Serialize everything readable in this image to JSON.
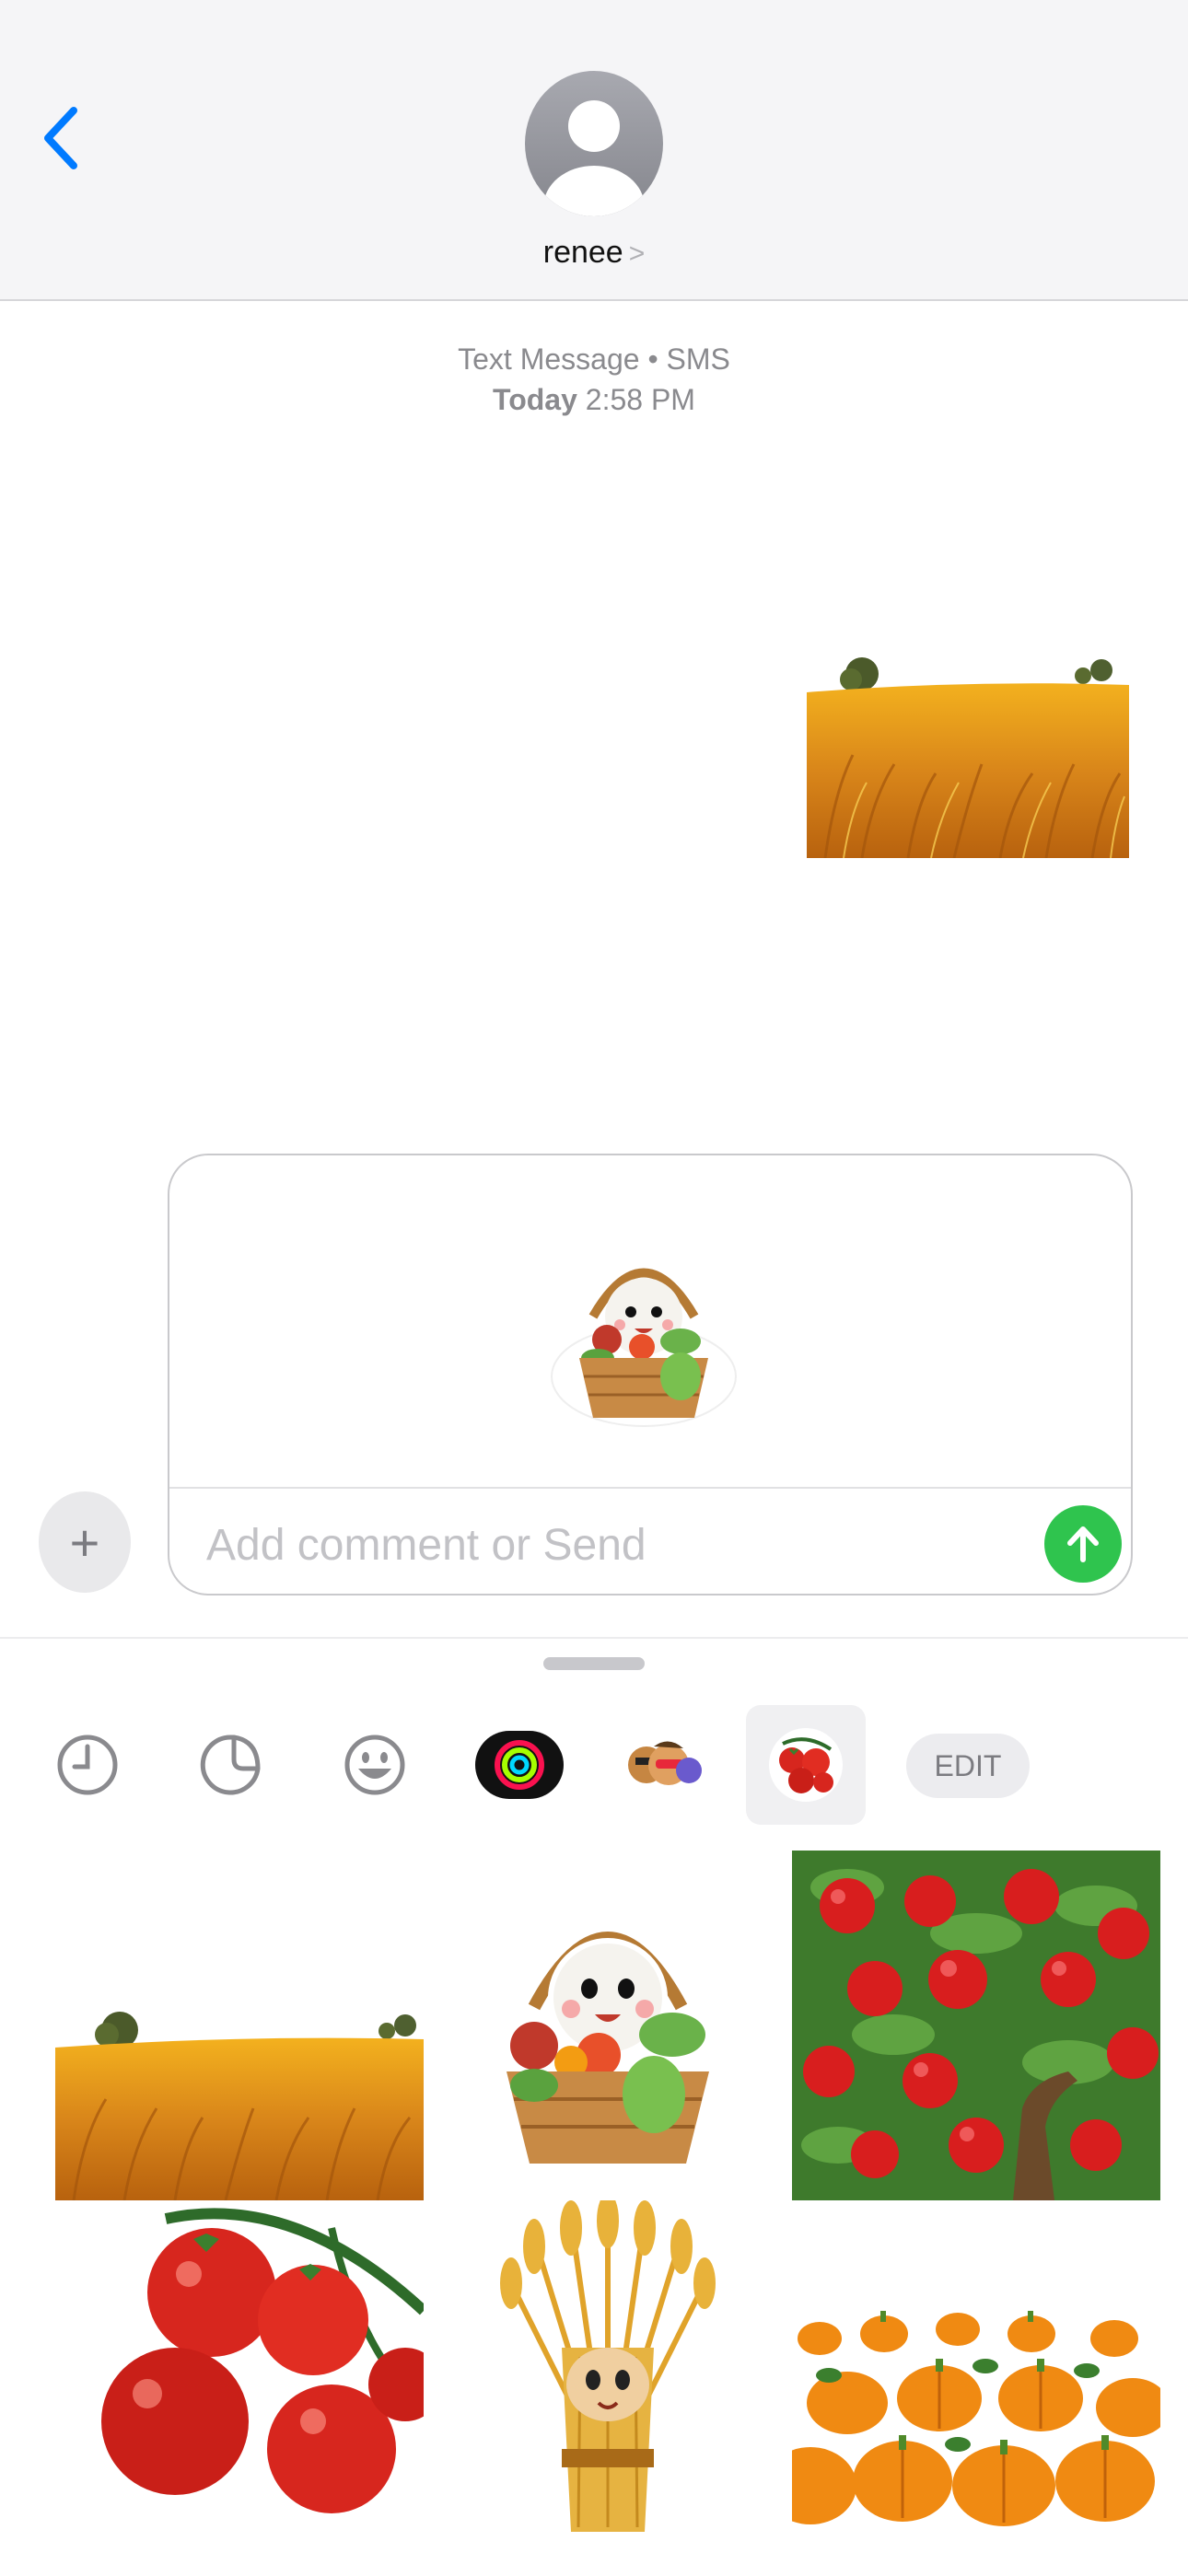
{
  "header": {
    "contact_name": "renee",
    "chevron": ">"
  },
  "conversation": {
    "service_label": "Text Message • SMS",
    "day_label": "Today",
    "time_label": "2:58 PM",
    "sent_image": "wheat-field-sticker"
  },
  "compose": {
    "placeholder": "Add comment or Send",
    "attached_sticker": "vegetable-basket-sticker",
    "plus_label": "+"
  },
  "drawer": {
    "tabs": [
      {
        "icon": "clock-icon"
      },
      {
        "icon": "sticker-icon"
      },
      {
        "icon": "emoji-icon"
      },
      {
        "icon": "activity-rings-icon"
      },
      {
        "icon": "memoji-icon"
      },
      {
        "icon": "tomato-stickers-icon",
        "selected": true
      }
    ],
    "edit_label": "EDIT",
    "stickers": [
      "wheat-field-sticker",
      "vegetable-basket-sticker",
      "apple-tree-sticker",
      "tomatoes-sticker",
      "wheat-sheaf-sticker",
      "pumpkin-patch-sticker"
    ]
  },
  "colors": {
    "accent": "#007aff",
    "send": "#2fc44e",
    "meta_text": "#8a8a8e"
  }
}
